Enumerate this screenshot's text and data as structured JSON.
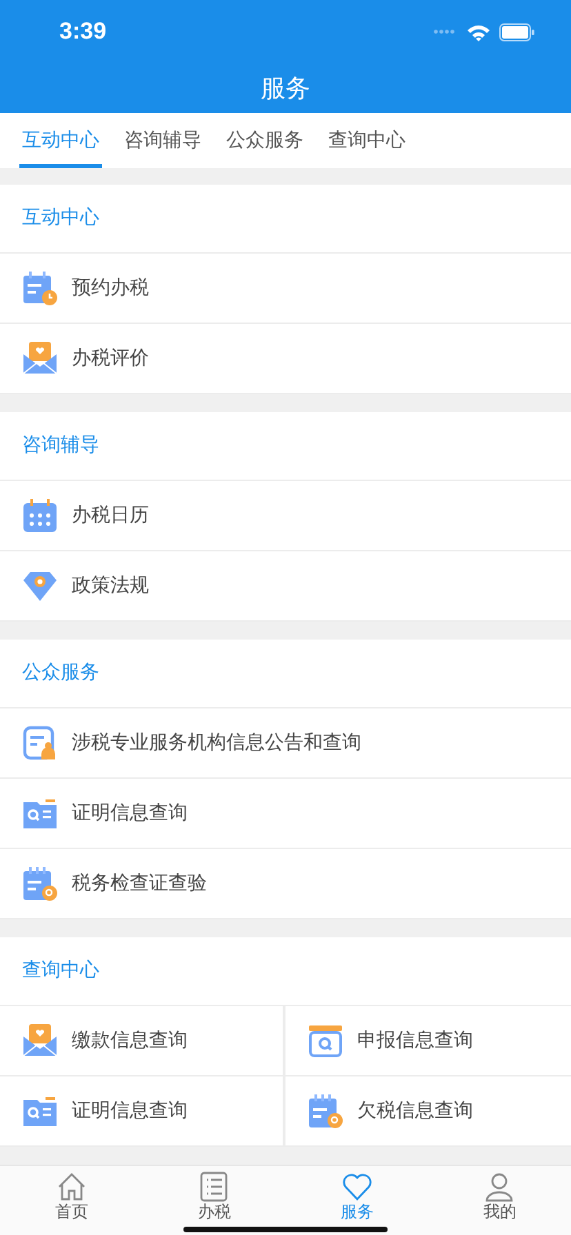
{
  "status_bar": {
    "time": "3:39"
  },
  "header": {
    "title": "服务"
  },
  "tabs": [
    {
      "label": "互动中心",
      "selected": true
    },
    {
      "label": "咨询辅导",
      "selected": false
    },
    {
      "label": "公众服务",
      "selected": false
    },
    {
      "label": "查询中心",
      "selected": false
    }
  ],
  "sections": [
    {
      "title": "互动中心",
      "kind": "list",
      "items": [
        {
          "label": "预约办税",
          "kind": "calendar-clock"
        },
        {
          "label": "办税评价",
          "kind": "envelope"
        }
      ]
    },
    {
      "title": "咨询辅导",
      "kind": "list",
      "items": [
        {
          "label": "办税日历",
          "kind": "calendar"
        },
        {
          "label": "政策法规",
          "kind": "diamond"
        }
      ]
    },
    {
      "title": "公众服务",
      "kind": "list",
      "items": [
        {
          "label": "涉税专业服务机构信息公告和查询",
          "kind": "document-person"
        },
        {
          "label": "证明信息查询",
          "kind": "folder-search"
        },
        {
          "label": "税务检查证查验",
          "kind": "notepad-search"
        }
      ]
    },
    {
      "title": "查询中心",
      "kind": "grid",
      "items": [
        {
          "label": "缴款信息查询",
          "kind": "envelope"
        },
        {
          "label": "申报信息查询",
          "kind": "window-search"
        },
        {
          "label": "证明信息查询",
          "kind": "folder-search"
        },
        {
          "label": "欠税信息查询",
          "kind": "notepad-search"
        }
      ]
    }
  ],
  "bottom_nav": [
    {
      "label": "首页",
      "kind": "home",
      "selected": false
    },
    {
      "label": "办税",
      "kind": "list",
      "selected": false
    },
    {
      "label": "服务",
      "kind": "heart",
      "selected": true
    },
    {
      "label": "我的",
      "kind": "person",
      "selected": false
    }
  ]
}
